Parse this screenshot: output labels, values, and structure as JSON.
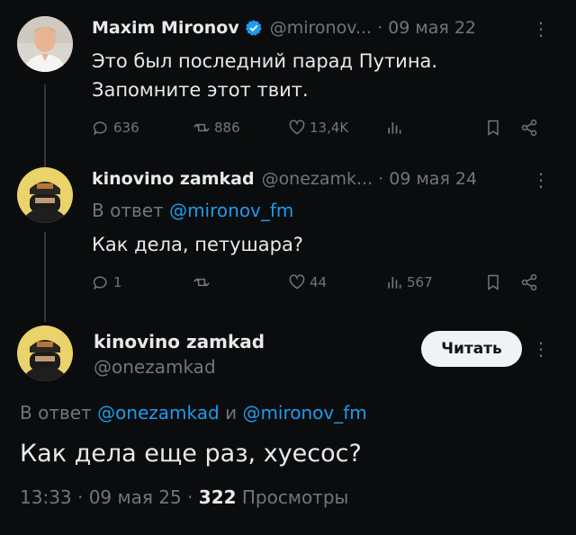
{
  "tweet1": {
    "name": "Maxim Mironov",
    "handle": "@mironov...",
    "date": "· 09 мая 22",
    "text_line1": "Это был последний парад Путина.",
    "text_line2": "Запомните этот твит.",
    "replies": "636",
    "retweets": "886",
    "likes": "13,4K",
    "views": ""
  },
  "tweet2": {
    "name": "kinovino zamkad",
    "handle": "@onezamk...",
    "date": "· 09 мая 24",
    "reply_prefix": "В ответ",
    "reply_handle": "@mironov_fm",
    "text": "Как дела, петушара?",
    "replies": "1",
    "retweets": "",
    "likes": "44",
    "views": "567"
  },
  "main": {
    "name": "kinovino zamkad",
    "handle": "@onezamkad",
    "read_button": "Читать",
    "reply_prefix": "В ответ",
    "reply_handle1": "@onezamkad",
    "reply_and": "и",
    "reply_handle2": "@mironov_fm",
    "text": "Как дела еще раз, хуесос?",
    "time": "13:33 · 09 мая 25 ·",
    "views_count": "322",
    "views_label": "Просмотры"
  },
  "colors": {
    "background": "#0b0c0d",
    "accent": "#1d9bf0",
    "muted": "#71767b",
    "verified": "#1d9bf0"
  },
  "icons": [
    "reply-icon",
    "retweet-icon",
    "like-icon",
    "views-icon",
    "bookmark-icon",
    "share-icon",
    "more-icon",
    "verified-icon"
  ]
}
